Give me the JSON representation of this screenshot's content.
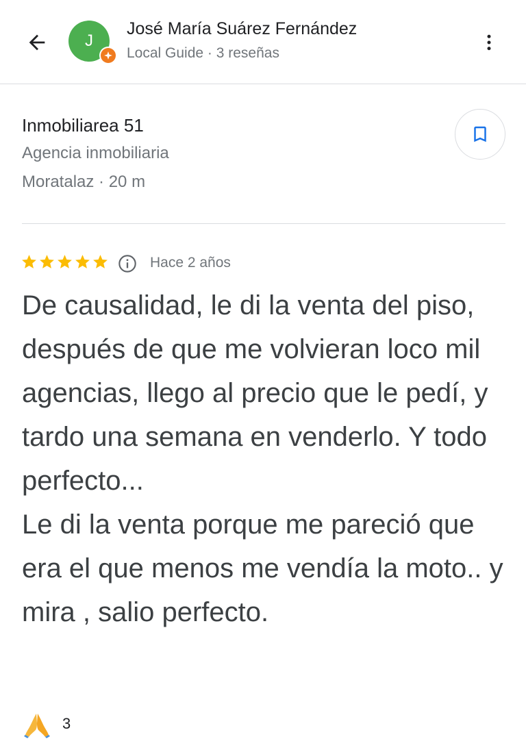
{
  "header": {
    "user_name": "José María Suárez Fernández",
    "user_meta": "Local Guide · 3 reseñas",
    "avatar_initial": "J",
    "back_icon": "arrow-back-icon",
    "more_icon": "more-vert-icon"
  },
  "place": {
    "name": "Inmobiliarea 51",
    "category": "Agencia inmobiliaria",
    "location": "Moratalaz · 20 m",
    "save_icon": "bookmark-icon"
  },
  "review": {
    "rating": 5,
    "rating_max": 5,
    "date": "Hace 2 años",
    "text": "De causalidad,  le di la venta del piso, después de que me volvieran loco mil agencias, llego al precio que le pedí, y tardo una semana en venderlo.  Y todo perfecto...\nLe di la venta porque me pareció que era el que menos me vendía la moto.. y mira , salio perfecto."
  },
  "reactions": {
    "emoji": "🙏",
    "count": "3"
  },
  "colors": {
    "avatar": "#4caf50",
    "local_guide_badge": "#f07b1f",
    "star": "#fbbc04",
    "bookmark": "#1a73e8"
  }
}
